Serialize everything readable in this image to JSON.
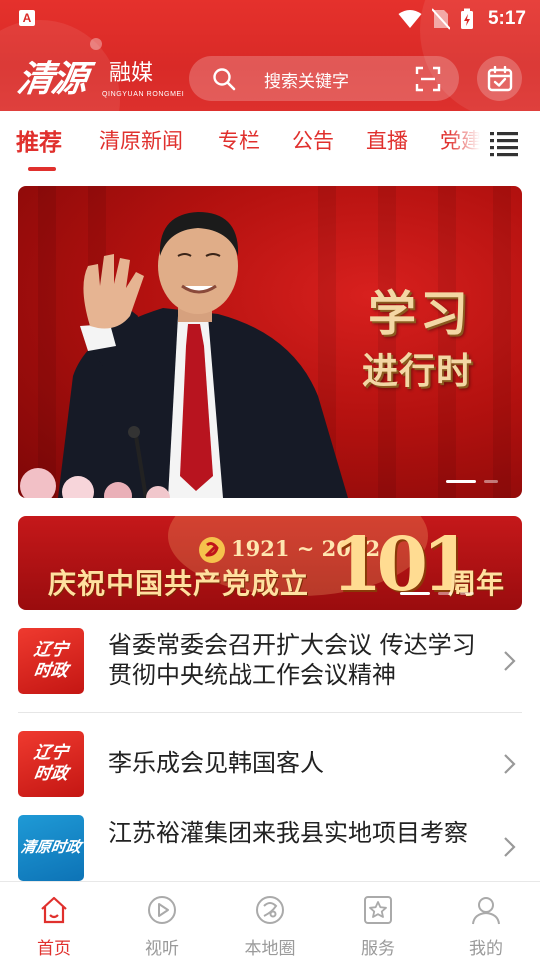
{
  "status_bar": {
    "app_badge": "A",
    "time": "5:17"
  },
  "header": {
    "logo_script": "清源",
    "logo_cn": "融媒",
    "logo_en": "QINGYUAN RONGMEI",
    "search_placeholder": "搜索关键字",
    "accent_color": "#e0302d"
  },
  "tabs": [
    {
      "label": "推荐",
      "active": true
    },
    {
      "label": "清原新闻"
    },
    {
      "label": "专栏"
    },
    {
      "label": "公告"
    },
    {
      "label": "直播"
    },
    {
      "label": "党建"
    }
  ],
  "hero": {
    "title_line1": "学习",
    "title_line2": "进行时",
    "slide_count": 2,
    "active_slide": 1
  },
  "banner2": {
    "years": "1921 ~ 2022",
    "text": "庆祝中国共产党成立",
    "number": "101",
    "suffix": "周年",
    "slide_count": 4,
    "active_slide": 1
  },
  "news": [
    {
      "thumb": "辽宁时政",
      "thumb_lines": [
        "辽宁",
        "时政"
      ],
      "thumb_color": "red",
      "title": "省委常委会召开扩大会议 传达学习贯彻中央统战工作会议精神"
    },
    {
      "thumb": "辽宁时政",
      "thumb_lines": [
        "辽宁",
        "时政"
      ],
      "thumb_color": "red",
      "title": "李乐成会见韩国客人"
    },
    {
      "thumb": "清原时政",
      "thumb_lines": [
        "清原时政"
      ],
      "thumb_color": "blue",
      "title": "江苏裕灌集团来我县实地项目考察"
    }
  ],
  "bottom_nav": [
    {
      "label": "首页",
      "icon": "home-icon",
      "active": true
    },
    {
      "label": "视听",
      "icon": "play-icon"
    },
    {
      "label": "本地圈",
      "icon": "local-circle-icon"
    },
    {
      "label": "服务",
      "icon": "service-star-icon"
    },
    {
      "label": "我的",
      "icon": "user-icon"
    }
  ]
}
